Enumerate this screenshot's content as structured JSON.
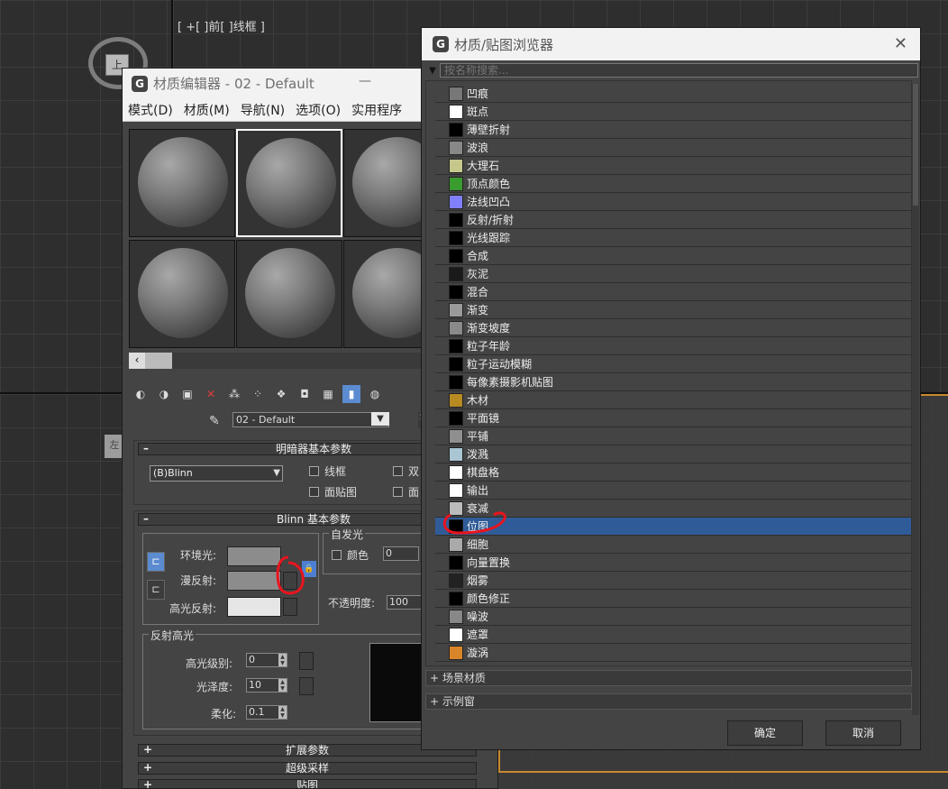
{
  "viewport": {
    "label": "[ +[ ]前[ ]线框 ]",
    "navcube_face": "上",
    "navcube2_face": "左"
  },
  "material_editor": {
    "title": "材质编辑器 - 02 - Default",
    "menu": [
      "模式(D)",
      "材质(M)",
      "导航(N)",
      "选项(O)",
      "实用程序"
    ],
    "material_name": "02 - Default",
    "stub_label": "S",
    "rollouts": {
      "shader_basic": "明暗器基本参数",
      "blinn_basic": "Blinn 基本参数",
      "extended": "扩展参数",
      "supersampling": "超级采样",
      "maps": "贴图"
    },
    "shader": {
      "selected": "(B)Blinn",
      "wire": "线框",
      "two_sided": "双",
      "face_map": "面贴图",
      "faceted": "面"
    },
    "blinn": {
      "ambient": "环境光:",
      "diffuse": "漫反射:",
      "specular": "高光反射:",
      "self_illum_group": "自发光",
      "color_label": "颜色",
      "color_value": "0",
      "opacity_label": "不透明度:",
      "opacity_value": "100",
      "spec_group": "反射高光",
      "spec_level_label": "高光级别:",
      "spec_level_value": "0",
      "gloss_label": "光泽度:",
      "gloss_value": "10",
      "soften_label": "柔化:",
      "soften_value": "0.1"
    }
  },
  "browser": {
    "title": "材质/贴图浏览器",
    "search_placeholder": "按名称搜索...",
    "items": [
      {
        "name": "凹痕",
        "color": "#777777"
      },
      {
        "name": "斑点",
        "color": "#ffffff"
      },
      {
        "name": "薄壁折射",
        "color": "#000000"
      },
      {
        "name": "波浪",
        "color": "#888888"
      },
      {
        "name": "大理石",
        "color": "#c5c88a"
      },
      {
        "name": "顶点颜色",
        "color": "#3a9b2e"
      },
      {
        "name": "法线凹凸",
        "color": "#8080ff"
      },
      {
        "name": "反射/折射",
        "color": "#000000"
      },
      {
        "name": "光线跟踪",
        "color": "#000000"
      },
      {
        "name": "合成",
        "color": "#000000"
      },
      {
        "name": "灰泥",
        "color": "#1a1a1a"
      },
      {
        "name": "混合",
        "color": "#000000"
      },
      {
        "name": "渐变",
        "color": "#9a9a9a"
      },
      {
        "name": "渐变坡度",
        "color": "#8a8a8a"
      },
      {
        "name": "粒子年龄",
        "color": "#000000"
      },
      {
        "name": "粒子运动模糊",
        "color": "#000000"
      },
      {
        "name": "每像素摄影机贴图",
        "color": "#000000"
      },
      {
        "name": "木材",
        "color": "#b88a22"
      },
      {
        "name": "平面镜",
        "color": "#000000"
      },
      {
        "name": "平铺",
        "color": "#8f8f8f"
      },
      {
        "name": "泼溅",
        "color": "#a9c6d2"
      },
      {
        "name": "棋盘格",
        "color": "#ffffff"
      },
      {
        "name": "输出",
        "color": "#ffffff"
      },
      {
        "name": "衰减",
        "color": "#bbbbbb"
      },
      {
        "name": "位图",
        "color": "#000000"
      },
      {
        "name": "细胞",
        "color": "#aaaaaa"
      },
      {
        "name": "向量置换",
        "color": "#000000"
      },
      {
        "name": "烟雾",
        "color": "#222222"
      },
      {
        "name": "颜色修正",
        "color": "#000000"
      },
      {
        "name": "噪波",
        "color": "#888888"
      },
      {
        "name": "遮罩",
        "color": "#ffffff"
      },
      {
        "name": "漩涡",
        "color": "#d9852a"
      }
    ],
    "selected_item": "位图",
    "sections": [
      "+ 场景材质",
      "+ 示例窗"
    ],
    "ok_label": "确定",
    "cancel_label": "取消"
  },
  "colors": {
    "accent": "#5b8bd0",
    "selection": "#2f5c99",
    "annotation": "#e8141e"
  }
}
